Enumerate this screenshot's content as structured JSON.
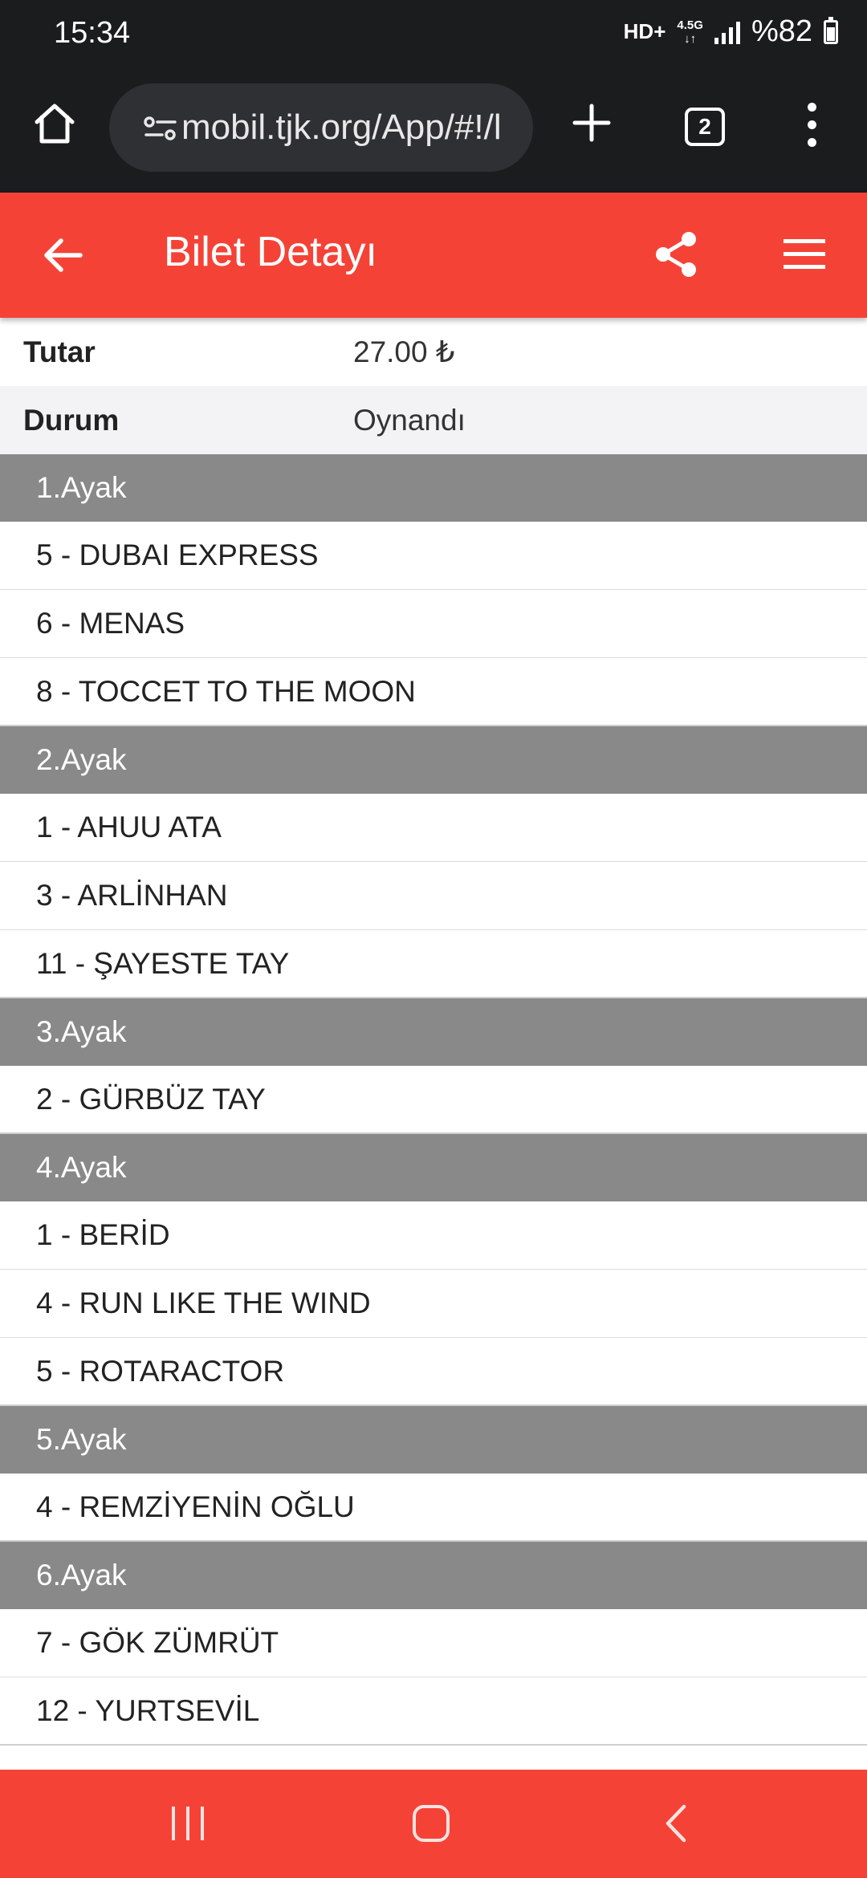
{
  "status_bar": {
    "time": "15:34",
    "network": "HD+",
    "net_type_top": "4.5G",
    "net_type_bottom": "↓↑",
    "battery": "%82"
  },
  "browser": {
    "url": "mobil.tjk.org/App/#!/l",
    "tab_count": "2"
  },
  "app_bar": {
    "title": "Bilet Detayı",
    "accent_color": "#f44336"
  },
  "summary": [
    {
      "label": "Tutar",
      "value": "27.00 ₺"
    },
    {
      "label": "Durum",
      "value": "Oynandı"
    }
  ],
  "legs": [
    {
      "title": "1.Ayak",
      "horses": [
        "5 - DUBAI EXPRESS",
        "6 - MENAS",
        "8 - TOCCET TO THE MOON"
      ]
    },
    {
      "title": "2.Ayak",
      "horses": [
        "1 - AHUU ATA",
        "3 - ARLİNHAN",
        "11 - ŞAYESTE TAY"
      ]
    },
    {
      "title": "3.Ayak",
      "horses": [
        "2 - GÜRBÜZ TAY"
      ]
    },
    {
      "title": "4.Ayak",
      "horses": [
        "1 - BERİD",
        "4 - RUN LIKE THE WIND",
        "5 - ROTARACTOR"
      ]
    },
    {
      "title": "5.Ayak",
      "horses": [
        "4 - REMZİYENİN OĞLU"
      ]
    },
    {
      "title": "6.Ayak",
      "horses": [
        "7 - GÖK ZÜMRÜT",
        "12 - YURTSEVİL"
      ]
    }
  ]
}
